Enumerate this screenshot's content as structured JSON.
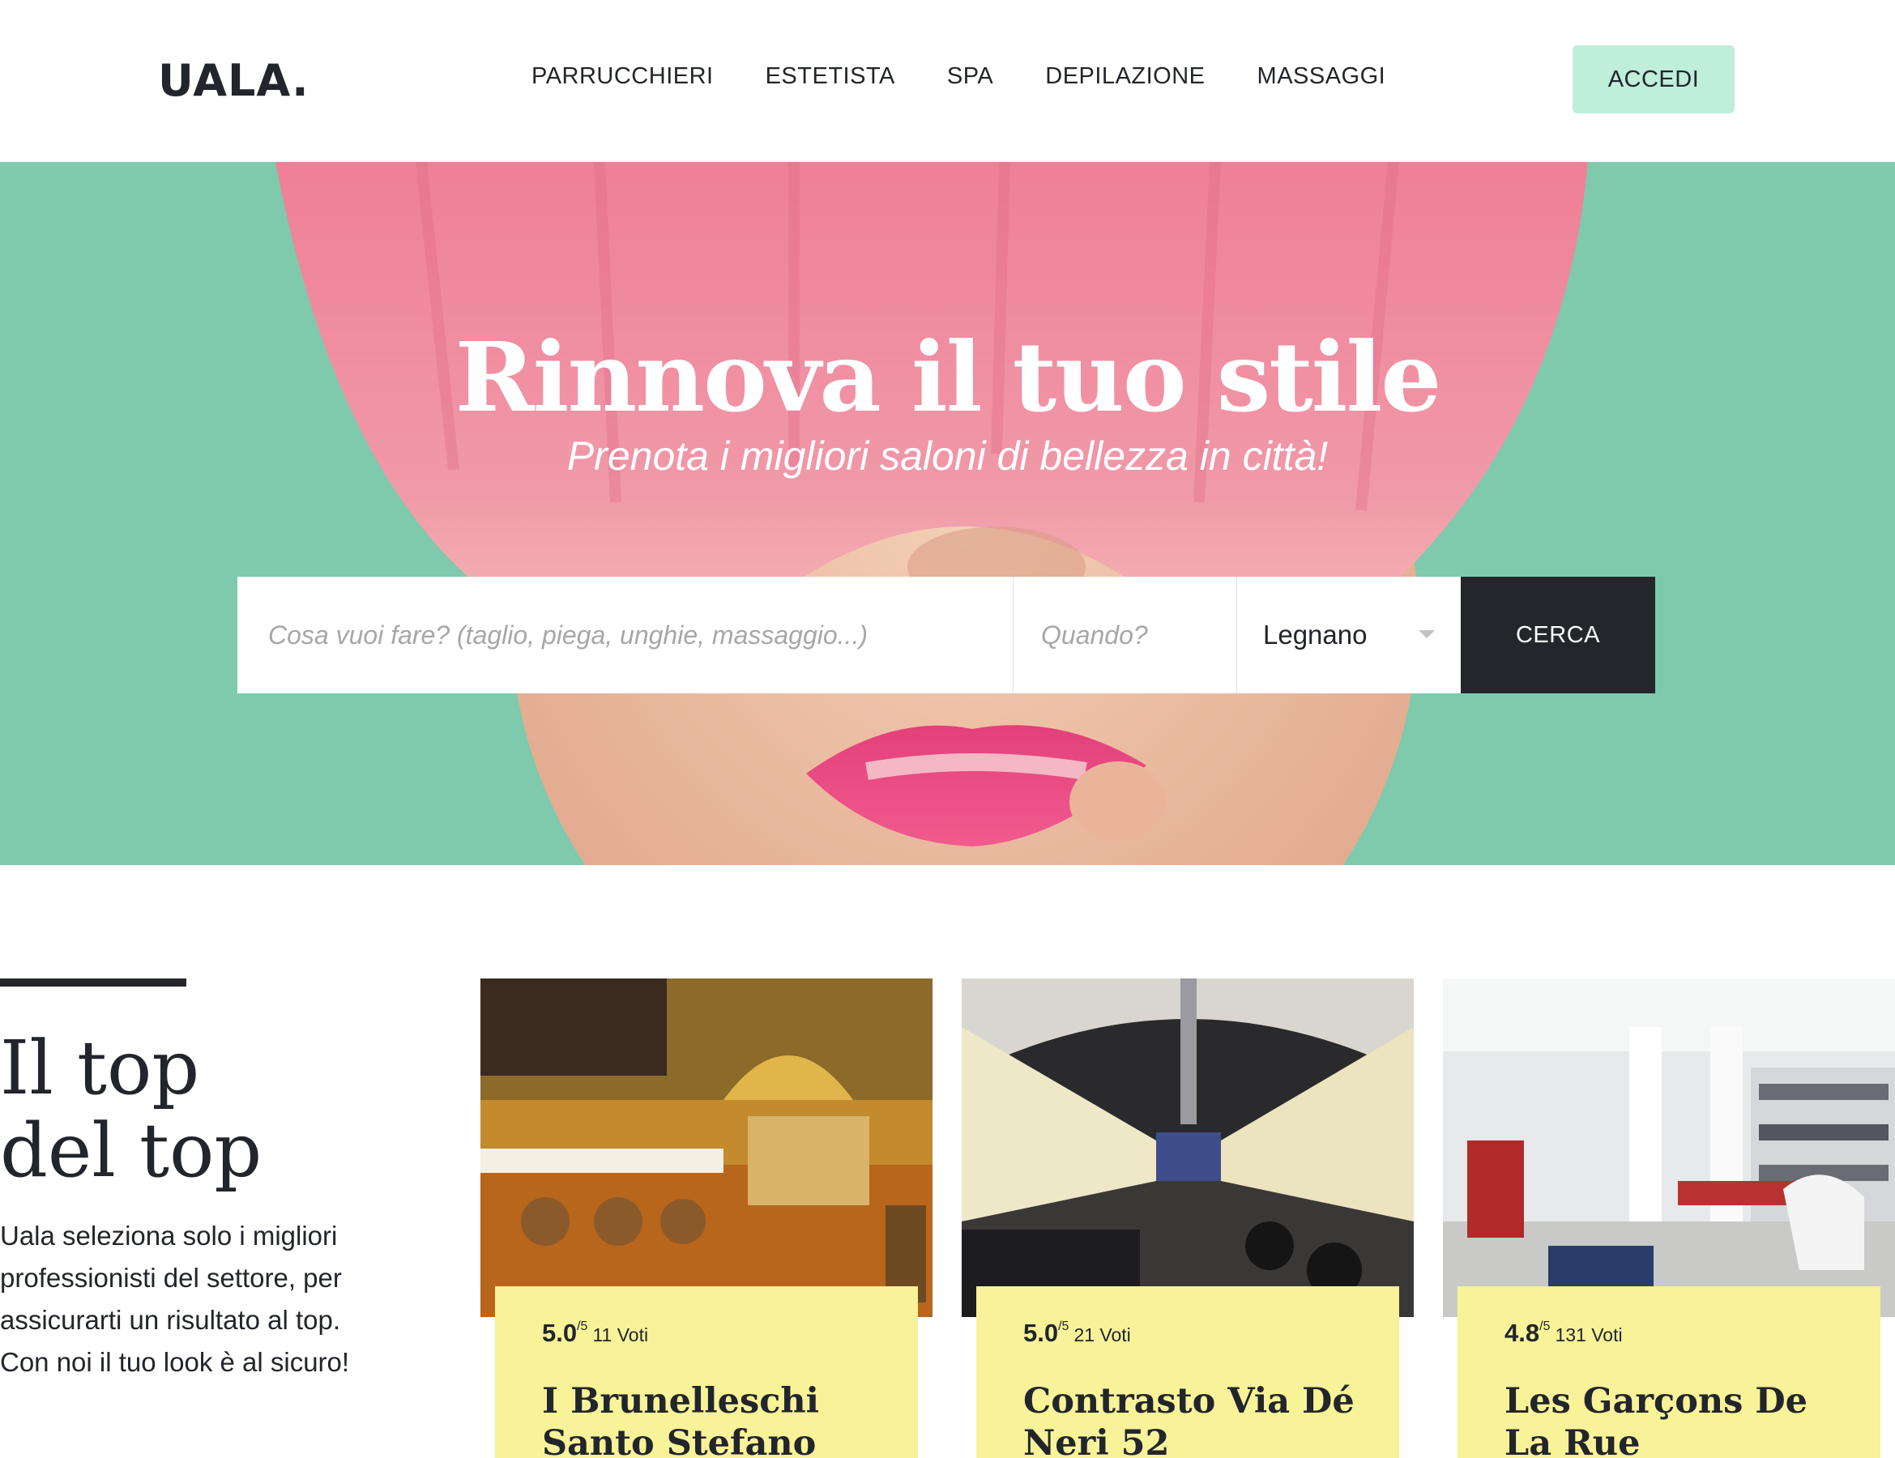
{
  "header": {
    "logo": "UALA.",
    "nav": [
      "PARRUCCHIERI",
      "ESTETISTA",
      "SPA",
      "DEPILAZIONE",
      "MASSAGGI"
    ],
    "login_label": "ACCEDI"
  },
  "hero": {
    "title": "Rinnova il tuo stile",
    "subtitle": "Prenota i migliori saloni di bellezza in città!",
    "search": {
      "what_placeholder": "Cosa vuoi fare? (taglio, piega, unghie, massaggio...)",
      "when_placeholder": "Quando?",
      "city_value": "Legnano",
      "submit_label": "CERCA"
    }
  },
  "top_section": {
    "title_line1": "Il top",
    "title_line2": "del top",
    "description": "Uala seleziona solo i migliori professionisti del settore, per assicurarti un risultato al top. Con noi il tuo look è al sicuro!"
  },
  "salons": [
    {
      "rating": "5.0",
      "rating_max": "/5",
      "votes": "11 Voti",
      "name": "I Brunelleschi Santo Stefano"
    },
    {
      "rating": "5.0",
      "rating_max": "/5",
      "votes": "21 Voti",
      "name": "Contrasto Via Dé Neri 52"
    },
    {
      "rating": "4.8",
      "rating_max": "/5",
      "votes": "131 Voti",
      "name": "Les Garçons De La Rue"
    }
  ],
  "colors": {
    "accent_mint": "#bfeedb",
    "hero_bg": "#7fc9ad",
    "card_yellow": "#f8f298",
    "dark": "#25262c"
  }
}
